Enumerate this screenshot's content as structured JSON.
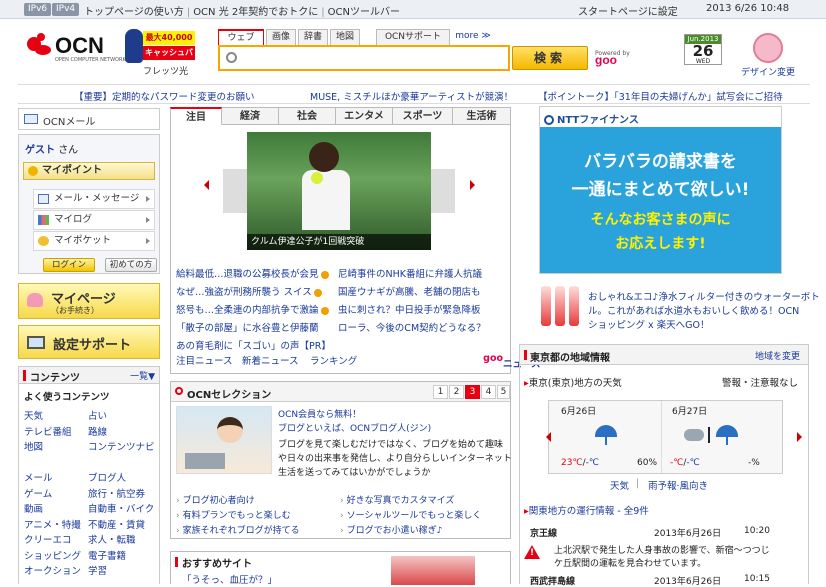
{
  "topbar": {
    "ipv6": "IPv6",
    "ipv4": "IPv4",
    "links": [
      "トップページの使い方",
      "OCN 光 2年契約でおトクに",
      "OCNツールバー"
    ],
    "set_start": "スタートページに設定",
    "datetime": "2013 6/26 10:48"
  },
  "header": {
    "logo_text": "OCN",
    "logo_sub": "OPEN COMPUTER NETWORK",
    "promo_line1": "最大40,000円",
    "promo_line2": "キャッシュバック!",
    "promo_caption": "フレッツ光",
    "search_tabs": [
      "ウェブ",
      "画像",
      "辞書",
      "地図",
      "OCNサポート",
      "more ≫"
    ],
    "search_placeholder": "",
    "search_button": "検索",
    "powered_label": "Powered by",
    "powered_brand": "goo",
    "calendar": {
      "month": "Jun.2013",
      "day": "26",
      "weekday": "WED"
    },
    "design_change": "デザイン変更"
  },
  "notice": {
    "left": "【重要】定期的なパスワード変更のお願い",
    "middle": "MUSE, ミスチルほか豪華アーティストが競演！",
    "right": "【ポイントーク】「31年目の夫婦げんか」試写会にご招待"
  },
  "left": {
    "mail": "OCNメール",
    "guest": "ゲスト",
    "guest_suffix": "さん",
    "mypoint": "マイポイント",
    "items": [
      "メール・メッセージ",
      "マイログ",
      "マイポケット"
    ],
    "login": "ログイン",
    "first_time": "初めての方",
    "mypage": "マイページ",
    "mypage_sub": "（お手続き）",
    "support": "設定サポート",
    "contents_title": "コンテンツ",
    "contents_all": "一覧▼",
    "contents_sub": "よく使うコンテンツ",
    "contents_col1": [
      "天気",
      "テレビ番組",
      "地図",
      "",
      "メール",
      "ゲーム",
      "動画",
      "アニメ・特撮",
      "クリーエコ",
      "ショッピング",
      "オークション"
    ],
    "contents_col2": [
      "占い",
      "路線",
      "コンテンツナビ",
      "",
      "ブログ人",
      "旅行・航空券",
      "自動車・バイク",
      "不動産・賃貸",
      "求人・転職",
      "電子書籍",
      "学習"
    ]
  },
  "news": {
    "tabs": [
      "注目",
      "経済",
      "社会",
      "エンタメ",
      "スポーツ",
      "生活術"
    ],
    "caption": "クルム伊達公子が1回戦突破",
    "headlines_left": [
      "給料最低…退職の公募校長が会見",
      "なぜ…強盗が刑務所襲う スイス",
      "怒号も…全柔連の内部抗争で激論",
      "「散子の部屋」に水谷豊と伊藤蘭",
      "あの育毛剤に「スゴい」の声【PR】"
    ],
    "headlines_right": [
      "尼崎事件のNHK番組に弁護人抗議",
      "国産ウナギが高騰、老舗の閉店も",
      "虫に刺され？中日投手が緊急降板",
      "ローラ、今後のCM契約どうなる？"
    ],
    "footer_links": [
      "注目ニュース",
      "新着ニュース",
      "ランキング"
    ],
    "goo_brand": "goo",
    "goo_news": "ニュース"
  },
  "selection": {
    "title": "OCNセレクション",
    "pages": [
      "1",
      "2",
      "3",
      "4",
      "5"
    ],
    "active_page": "3",
    "text_lines": [
      "OCN会員なら無料！",
      "ブログといえば、OCNブログ人(ジン)",
      "ブログを見て楽しむだけではなく、ブログを始めて趣味",
      "や日々の出来事を発信し、より自分らしいインターネット",
      "生活を送ってみてはいかがでしょうか"
    ],
    "links_left": [
      "ブログ初心者向け",
      "有料プランでもっと楽しむ",
      "家族それぞれブログが持てる"
    ],
    "links_right": [
      "好きな写真でカスタマイズ",
      "ソーシャルツールでもっと楽しく",
      "ブログでお小遣い稼ぎ♪"
    ]
  },
  "recommend": {
    "title": "おすすめサイト",
    "item": "「うそっ、血圧が？」"
  },
  "ad": {
    "brand": "NTTファイナンス",
    "line1": "バラバラの請求書を",
    "line2": "一通にまとめて欲しい!",
    "line3": "そんなお客さまの声に",
    "line4": "お応えします!"
  },
  "water_ad": {
    "lines": [
      "おしゃれ&エコ♪浄水フィルター付きのウォーターボト",
      "ル。これがあれば水道水もおいしく飲める！OCN",
      "ショッピング x 楽天へGO！"
    ]
  },
  "regional": {
    "title": "東京都の地域情報",
    "change": "地域を変更",
    "weather_region": "東京(東京)地方の天気",
    "alerts": "警報・注意報なし",
    "days": [
      {
        "date": "6月26日",
        "hi": "23℃",
        "lo": "-℃",
        "pct": "60%"
      },
      {
        "date": "6月27日",
        "hi": "-℃",
        "lo": "-℃",
        "pct": "-%"
      }
    ],
    "weather_link": "天気",
    "rain_link": "雨予報·風向き",
    "train_title": "関東地方の運行情報 - 全9件",
    "train1_line": "京王線",
    "train1_date": "2013年6月26日",
    "train1_time": "10:20",
    "train1_desc1": "上北沢駅で発生した人身事故の影響で、新宿〜つつじ",
    "train1_desc2": "ケ丘駅間の運転を見合わせています。",
    "train2_line": "西武拝島線",
    "train2_date": "2013年6月26日",
    "train2_time": "10:15"
  }
}
